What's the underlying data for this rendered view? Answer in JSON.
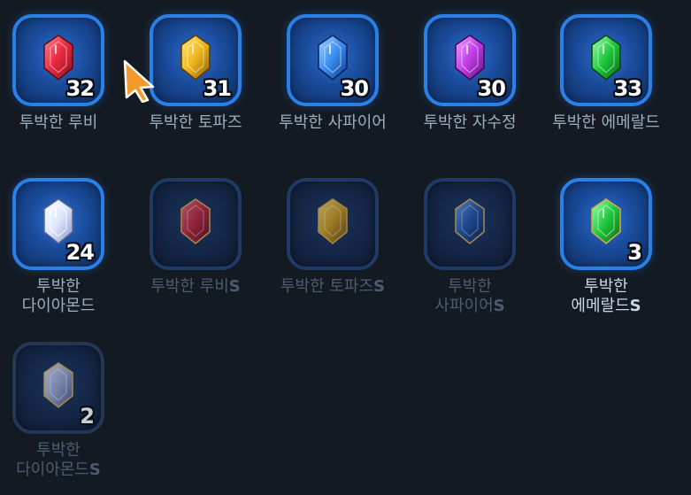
{
  "colors": {
    "ruby": "#e8283e",
    "topaz": "#f0b81a",
    "sapphire": "#3a8ef0",
    "amethyst": "#c23ee8",
    "emerald": "#1ec83a",
    "diamond": "#e6ecff",
    "slot_border_active": "#2a80e6",
    "cursor": "#f39a2c"
  },
  "items": [
    {
      "name_line1": "투박한 루비",
      "name_line2": "",
      "suffix": "",
      "count": "32",
      "gem": "ruby",
      "active": true
    },
    {
      "name_line1": "투박한 토파즈",
      "name_line2": "",
      "suffix": "",
      "count": "31",
      "gem": "topaz",
      "active": true
    },
    {
      "name_line1": "투박한 사파이어",
      "name_line2": "",
      "suffix": "",
      "count": "30",
      "gem": "sapphire",
      "active": true
    },
    {
      "name_line1": "투박한 자수정",
      "name_line2": "",
      "suffix": "",
      "count": "30",
      "gem": "amethyst",
      "active": true
    },
    {
      "name_line1": "투박한 에메랄드",
      "name_line2": "",
      "suffix": "",
      "count": "33",
      "gem": "emerald",
      "active": true
    },
    {
      "name_line1": "투박한",
      "name_line2": "다이아몬드",
      "suffix": "",
      "count": "24",
      "gem": "diamond",
      "active": true
    },
    {
      "name_line1": "투박한 루비",
      "name_line2": "",
      "suffix": "S",
      "count": "",
      "gem": "ruby",
      "active": false
    },
    {
      "name_line1": "투박한 토파즈",
      "name_line2": "",
      "suffix": "S",
      "count": "",
      "gem": "topaz",
      "active": false
    },
    {
      "name_line1": "투박한",
      "name_line2": "사파이어",
      "suffix": "S",
      "count": "",
      "gem": "sapphire",
      "active": false
    },
    {
      "name_line1": "투박한",
      "name_line2": "에메랄드",
      "suffix": "S",
      "count": "3",
      "gem": "emerald",
      "active": true
    },
    {
      "name_line1": "투박한",
      "name_line2": "다이아몬드",
      "suffix": "S",
      "count": "2",
      "gem": "diamond",
      "active": false
    }
  ],
  "cursor_icon": "pointer-arrow-icon"
}
